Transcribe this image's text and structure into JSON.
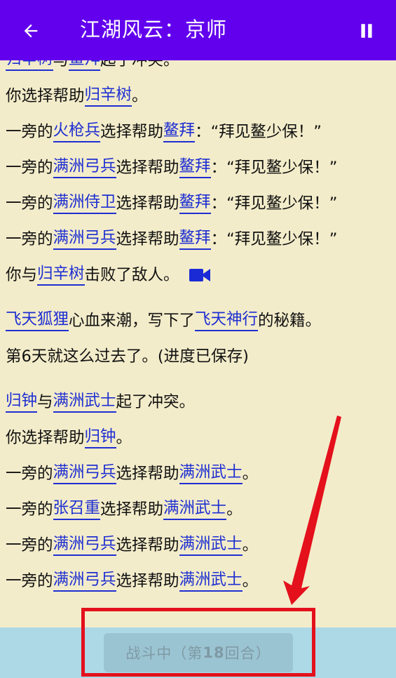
{
  "appbar": {
    "title": "江湖风云：京师",
    "back_icon": "arrow-left-icon",
    "pause_icon": "pause-icon",
    "color": "#6200ee"
  },
  "log": {
    "lines": [
      {
        "parts": [
          {
            "t": "归辛树",
            "link": true
          },
          {
            "t": "与"
          },
          {
            "t": "鳌拜",
            "link": true
          },
          {
            "t": "起了冲突。"
          }
        ]
      },
      {
        "parts": [
          {
            "t": "你选择帮助"
          },
          {
            "t": "归辛树",
            "link": true
          },
          {
            "t": "。"
          }
        ]
      },
      {
        "parts": [
          {
            "t": "一旁的"
          },
          {
            "t": "火枪兵",
            "link": true
          },
          {
            "t": "选择帮助"
          },
          {
            "t": "鳌拜",
            "link": true
          },
          {
            "t": "：“拜见鳌少保！”"
          }
        ]
      },
      {
        "parts": [
          {
            "t": "一旁的"
          },
          {
            "t": "满洲弓兵",
            "link": true
          },
          {
            "t": "选择帮助"
          },
          {
            "t": "鳌拜",
            "link": true
          },
          {
            "t": "：“拜见鳌少保！”"
          }
        ]
      },
      {
        "parts": [
          {
            "t": "一旁的"
          },
          {
            "t": "满洲侍卫",
            "link": true
          },
          {
            "t": "选择帮助"
          },
          {
            "t": "鳌拜",
            "link": true
          },
          {
            "t": "：“拜见鳌少保！”"
          }
        ]
      },
      {
        "parts": [
          {
            "t": "一旁的"
          },
          {
            "t": "满洲弓兵",
            "link": true
          },
          {
            "t": "选择帮助"
          },
          {
            "t": "鳌拜",
            "link": true
          },
          {
            "t": "：“拜见鳌少保！”"
          }
        ]
      },
      {
        "parts": [
          {
            "t": "你与"
          },
          {
            "t": "归辛树",
            "link": true
          },
          {
            "t": "击败了敌人。"
          }
        ],
        "video": true
      },
      {
        "gap": true,
        "parts": [
          {
            "t": "飞天狐狸",
            "link": true
          },
          {
            "t": "心血来潮，写下了"
          },
          {
            "t": "飞天神行",
            "link": true
          },
          {
            "t": "的秘籍。"
          }
        ]
      },
      {
        "parts": [
          {
            "t": "第6天就这么过去了。(进度已保存)"
          }
        ]
      },
      {
        "gap": true,
        "parts": [
          {
            "t": "归钟",
            "link": true
          },
          {
            "t": "与"
          },
          {
            "t": "满洲武士",
            "link": true
          },
          {
            "t": "起了冲突。"
          }
        ]
      },
      {
        "parts": [
          {
            "t": "你选择帮助"
          },
          {
            "t": "归钟",
            "link": true
          },
          {
            "t": "。"
          }
        ]
      },
      {
        "parts": [
          {
            "t": "一旁的"
          },
          {
            "t": "满洲弓兵",
            "link": true
          },
          {
            "t": "选择帮助"
          },
          {
            "t": "满洲武士",
            "link": true
          },
          {
            "t": "。"
          }
        ]
      },
      {
        "parts": [
          {
            "t": "一旁的"
          },
          {
            "t": "张召重",
            "link": true
          },
          {
            "t": "选择帮助"
          },
          {
            "t": "满洲武士",
            "link": true
          },
          {
            "t": "。"
          }
        ]
      },
      {
        "parts": [
          {
            "t": "一旁的"
          },
          {
            "t": "满洲弓兵",
            "link": true
          },
          {
            "t": "选择帮助"
          },
          {
            "t": "满洲武士",
            "link": true
          },
          {
            "t": "。"
          }
        ]
      },
      {
        "parts": [
          {
            "t": "一旁的"
          },
          {
            "t": "满洲弓兵",
            "link": true
          },
          {
            "t": "选择帮助"
          },
          {
            "t": "满洲武士",
            "link": true
          },
          {
            "t": "。"
          }
        ]
      }
    ],
    "video_icon": "video-camera-icon",
    "link_color": "#1f2fd2",
    "background": "#f3ecca"
  },
  "bottom": {
    "battle_label_prefix": "战斗中（第",
    "battle_round": "18",
    "battle_label_suffix": "回合）",
    "bar_color": "#add8e6"
  },
  "annotation": {
    "highlight_color": "#e4101c"
  }
}
